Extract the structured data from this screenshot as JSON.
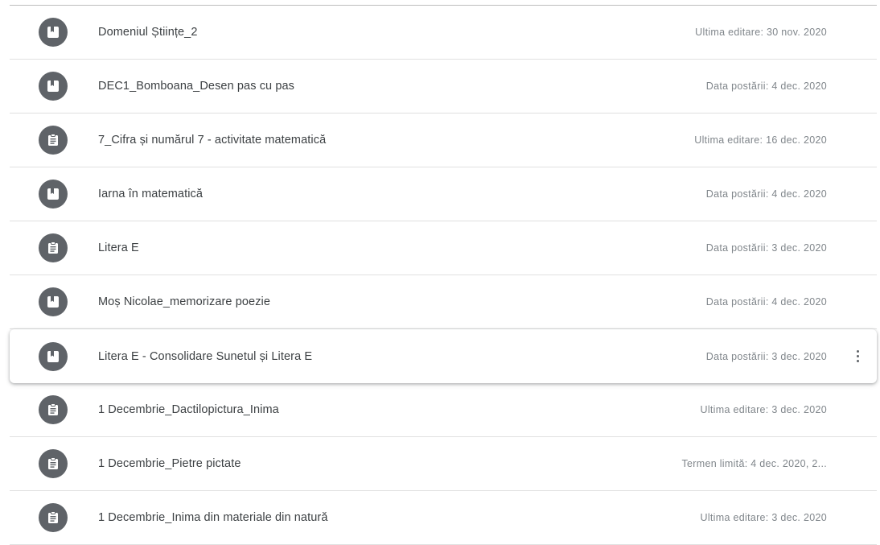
{
  "items": [
    {
      "title": "Domeniul Științe_2",
      "meta": "Ultima editare: 30 nov. 2020",
      "icon": "material-icon"
    },
    {
      "title": "DEC1_Bomboana_Desen pas cu pas",
      "meta": "Data postării: 4 dec. 2020",
      "icon": "material-icon"
    },
    {
      "title": "7_Cifra și numărul 7 - activitate matematică",
      "meta": "Ultima editare: 16 dec. 2020",
      "icon": "assignment-icon"
    },
    {
      "title": "Iarna în matematică",
      "meta": "Data postării: 4 dec. 2020",
      "icon": "material-icon"
    },
    {
      "title": "Litera E",
      "meta": "Data postării: 3 dec. 2020",
      "icon": "assignment-icon"
    },
    {
      "title": "Moș Nicolae_memorizare poezie",
      "meta": "Data postării: 4 dec. 2020",
      "icon": "material-icon"
    },
    {
      "title": "Litera E - Consolidare Sunetul și Litera E",
      "meta": "Data postării: 3 dec. 2020",
      "icon": "material-icon"
    },
    {
      "title": "1 Decembrie_Dactilopictura_Inima",
      "meta": "Ultima editare: 3 dec. 2020",
      "icon": "assignment-icon"
    },
    {
      "title": "1 Decembrie_Pietre pictate",
      "meta": "Termen limită: 4 dec. 2020, 2...",
      "icon": "assignment-icon"
    },
    {
      "title": "1 Decembrie_Inima din materiale din natură",
      "meta": "Ultima editare: 3 dec. 2020",
      "icon": "assignment-icon"
    }
  ],
  "more_menu_icon": "more-vert-icon",
  "colors": {
    "icon_bg": "#5f6368",
    "title_text": "#3c4043",
    "meta_text": "#80868b",
    "divider": "#e0e0e0"
  }
}
